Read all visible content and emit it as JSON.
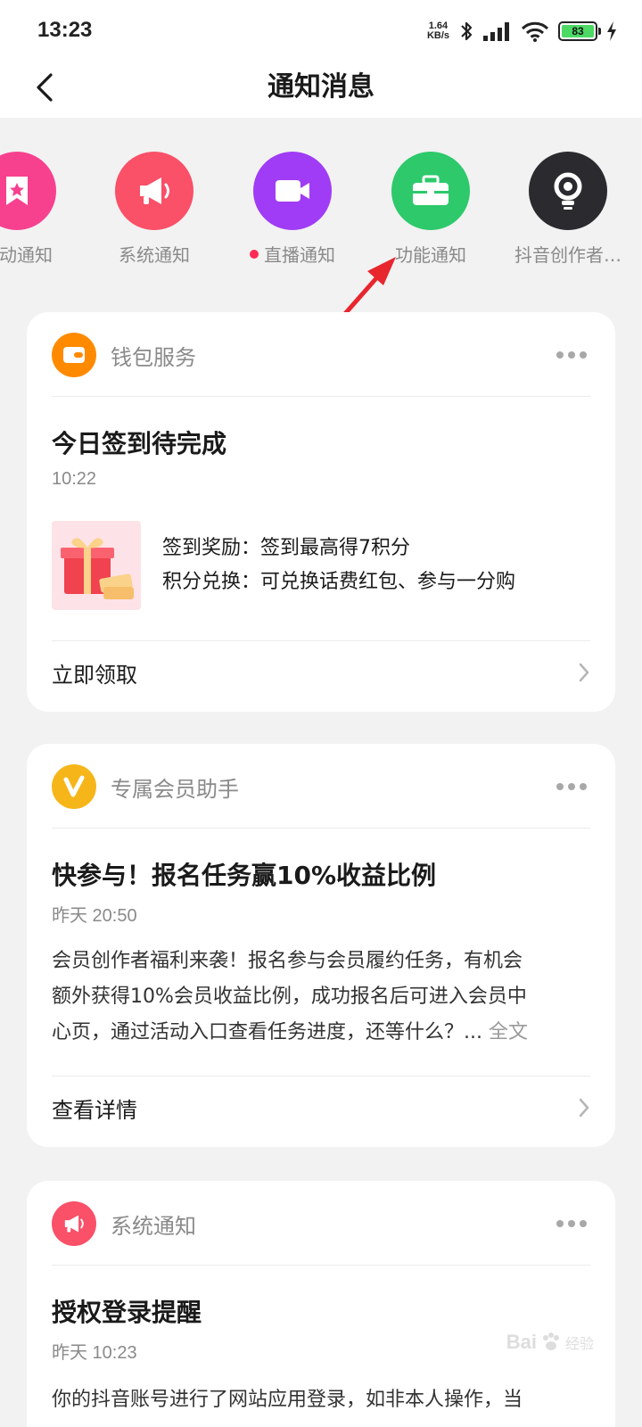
{
  "status_bar": {
    "time": "13:23",
    "net_speed_value": "1.64",
    "net_speed_unit": "KB/s",
    "battery_level": "83",
    "icons": [
      "bluetooth-icon",
      "signal-icon",
      "wifi-icon",
      "battery-icon",
      "charging-icon"
    ]
  },
  "header": {
    "title": "通知消息",
    "back_icon": "chevron-left-icon"
  },
  "categories": [
    {
      "label": "活动通知",
      "color": "#f7418f",
      "icon": "bookmark-star-icon",
      "unread": false
    },
    {
      "label": "系统通知",
      "color": "#fa5068",
      "icon": "megaphone-icon",
      "unread": false
    },
    {
      "label": "直播通知",
      "color": "#a03cf5",
      "icon": "video-camera-icon",
      "unread": true
    },
    {
      "label": "功能通知",
      "color": "#2dc96b",
      "icon": "briefcase-icon",
      "unread": false
    },
    {
      "label": "抖音创作者…",
      "color": "#2b2b2f",
      "icon": "lightbulb-icon",
      "unread": false
    }
  ],
  "cards": [
    {
      "source": "钱包服务",
      "avatar_color": "#ff8a00",
      "avatar_icon": "wallet-icon",
      "title": "今日签到待完成",
      "time": "10:22",
      "reward_lines": [
        "签到奖励：签到最高得7积分",
        "积分兑换：可兑换话费红包、参与一分购"
      ],
      "action": "立即领取"
    },
    {
      "source": "专属会员助手",
      "avatar_color": "#f6b619",
      "avatar_icon": "v-badge-icon",
      "title": "快参与！报名任务赢10%收益比例",
      "time": "昨天 20:50",
      "body_lines": [
        "会员创作者福利来袭！报名参与会员履约任务，有机会",
        "额外获得10%会员收益比例，成功报名后可进入会员中",
        "心页，通过活动入口查看任务进度，还等什么？..."
      ],
      "body_more": "全文",
      "action": "查看详情"
    },
    {
      "source": "系统通知",
      "avatar_color": "#fa5068",
      "avatar_icon": "megaphone-icon",
      "title": "授权登录提醒",
      "time": "昨天 10:23",
      "body_lines": [
        "你的抖音账号进行了网站应用登录，如非本人操作，当"
      ]
    }
  ],
  "watermark": {
    "brand": "Bai",
    "sub": "经验"
  },
  "annotation": {
    "color": "#e8262e"
  }
}
